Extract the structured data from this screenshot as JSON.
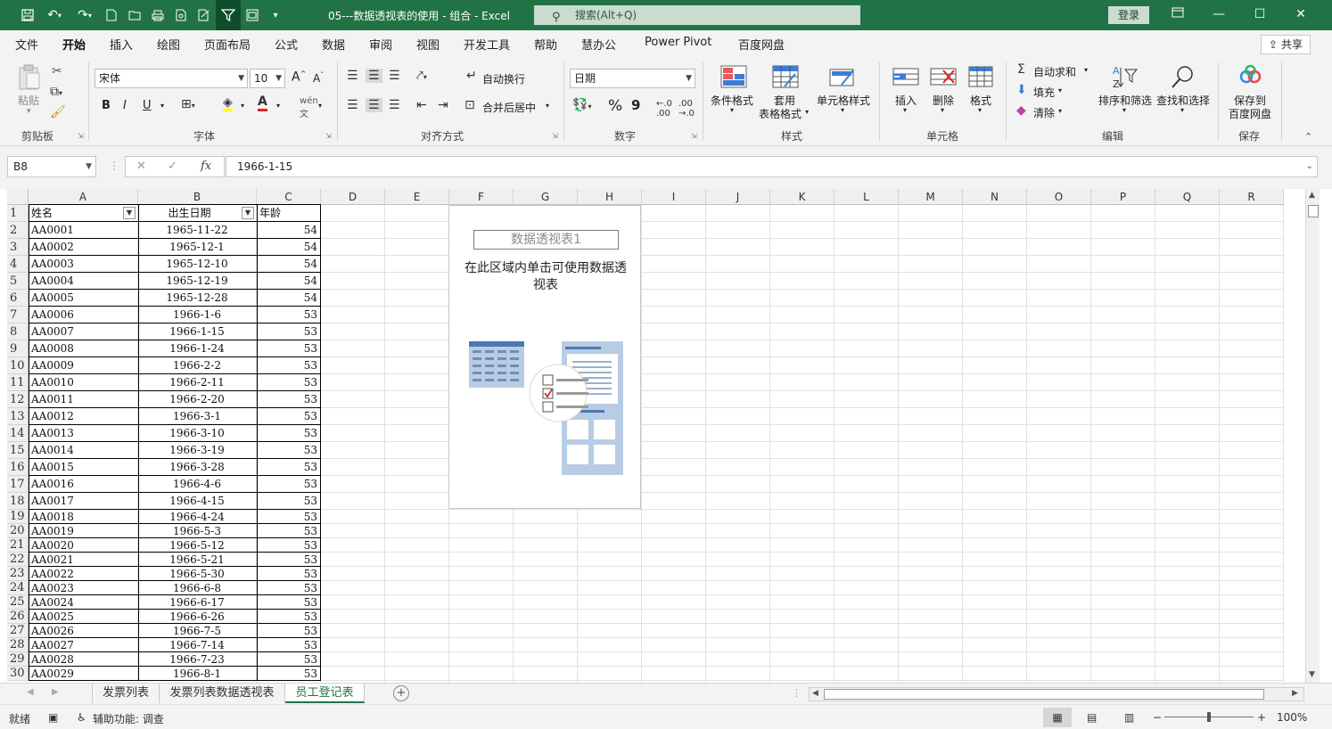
{
  "titlebar": {
    "doc_title": "05---数据透视表的使用 - 组合  -  Excel",
    "search_placeholder": "搜索(Alt+Q)",
    "login_label": "登录"
  },
  "menu": {
    "tabs": [
      "文件",
      "开始",
      "插入",
      "绘图",
      "页面布局",
      "公式",
      "数据",
      "审阅",
      "视图",
      "开发工具",
      "帮助",
      "慧办公",
      "Power Pivot",
      "百度网盘"
    ],
    "active": "开始",
    "share_label": "共享"
  },
  "ribbon": {
    "clipboard": {
      "paste": "粘贴",
      "label": "剪贴板"
    },
    "font": {
      "name": "宋体",
      "size": "10",
      "label": "字体",
      "bold": "B",
      "italic": "I",
      "underline": "U",
      "grow": "A",
      "shrink": "A"
    },
    "align": {
      "wrap": "自动换行",
      "merge": "合并后居中",
      "label": "对齐方式"
    },
    "number": {
      "format": "日期",
      "label": "数字",
      "percent": "%",
      "comma": "9"
    },
    "styles": {
      "cond": "条件格式",
      "table_1": "套用",
      "table_2": "表格格式",
      "cell": "单元格样式",
      "label": "样式"
    },
    "cells": {
      "insert": "插入",
      "delete": "删除",
      "format": "格式",
      "label": "单元格"
    },
    "edit": {
      "autosum": "自动求和",
      "fill": "填充",
      "clear": "清除",
      "sort": "排序和筛选",
      "find": "查找和选择",
      "label": "编辑"
    },
    "save": {
      "label_1": "保存到",
      "label_2": "百度网盘",
      "group": "保存"
    }
  },
  "formula_bar": {
    "name_box": "B8",
    "formula": "1966-1-15",
    "fx": "fx"
  },
  "columns": [
    "A",
    "B",
    "C",
    "D",
    "E",
    "F",
    "G",
    "H",
    "I",
    "J",
    "K",
    "L",
    "M",
    "N",
    "O",
    "P",
    "Q",
    "R"
  ],
  "table": {
    "headers": [
      "姓名",
      "出生日期",
      "年龄"
    ],
    "rows": [
      [
        "AA0001",
        "1965-11-22",
        "54"
      ],
      [
        "AA0002",
        "1965-12-1",
        "54"
      ],
      [
        "AA0003",
        "1965-12-10",
        "54"
      ],
      [
        "AA0004",
        "1965-12-19",
        "54"
      ],
      [
        "AA0005",
        "1965-12-28",
        "54"
      ],
      [
        "AA0006",
        "1966-1-6",
        "53"
      ],
      [
        "AA0007",
        "1966-1-15",
        "53"
      ],
      [
        "AA0008",
        "1966-1-24",
        "53"
      ],
      [
        "AA0009",
        "1966-2-2",
        "53"
      ],
      [
        "AA0010",
        "1966-2-11",
        "53"
      ],
      [
        "AA0011",
        "1966-2-20",
        "53"
      ],
      [
        "AA0012",
        "1966-3-1",
        "53"
      ],
      [
        "AA0013",
        "1966-3-10",
        "53"
      ],
      [
        "AA0014",
        "1966-3-19",
        "53"
      ],
      [
        "AA0015",
        "1966-3-28",
        "53"
      ],
      [
        "AA0016",
        "1966-4-6",
        "53"
      ],
      [
        "AA0017",
        "1966-4-15",
        "53"
      ],
      [
        "AA0018",
        "1966-4-24",
        "53"
      ],
      [
        "AA0019",
        "1966-5-3",
        "53"
      ],
      [
        "AA0020",
        "1966-5-12",
        "53"
      ],
      [
        "AA0021",
        "1966-5-21",
        "53"
      ],
      [
        "AA0022",
        "1966-5-30",
        "53"
      ],
      [
        "AA0023",
        "1966-6-8",
        "53"
      ],
      [
        "AA0024",
        "1966-6-17",
        "53"
      ],
      [
        "AA0025",
        "1966-6-26",
        "53"
      ],
      [
        "AA0026",
        "1966-7-5",
        "53"
      ],
      [
        "AA0027",
        "1966-7-14",
        "53"
      ],
      [
        "AA0028",
        "1966-7-23",
        "53"
      ],
      [
        "AA0029",
        "1966-8-1",
        "53"
      ]
    ]
  },
  "pivot": {
    "name": "数据透视表1",
    "hint_line1": "在此区域内单击可使用数据透",
    "hint_line2": "视表"
  },
  "sheets": {
    "tabs": [
      "发票列表",
      "发票列表数据透视表",
      "员工登记表"
    ],
    "active": "员工登记表"
  },
  "status": {
    "mode": "就绪",
    "accessibility": "辅助功能: 调查",
    "zoom": "100%"
  },
  "colors": {
    "brand": "#217346"
  }
}
